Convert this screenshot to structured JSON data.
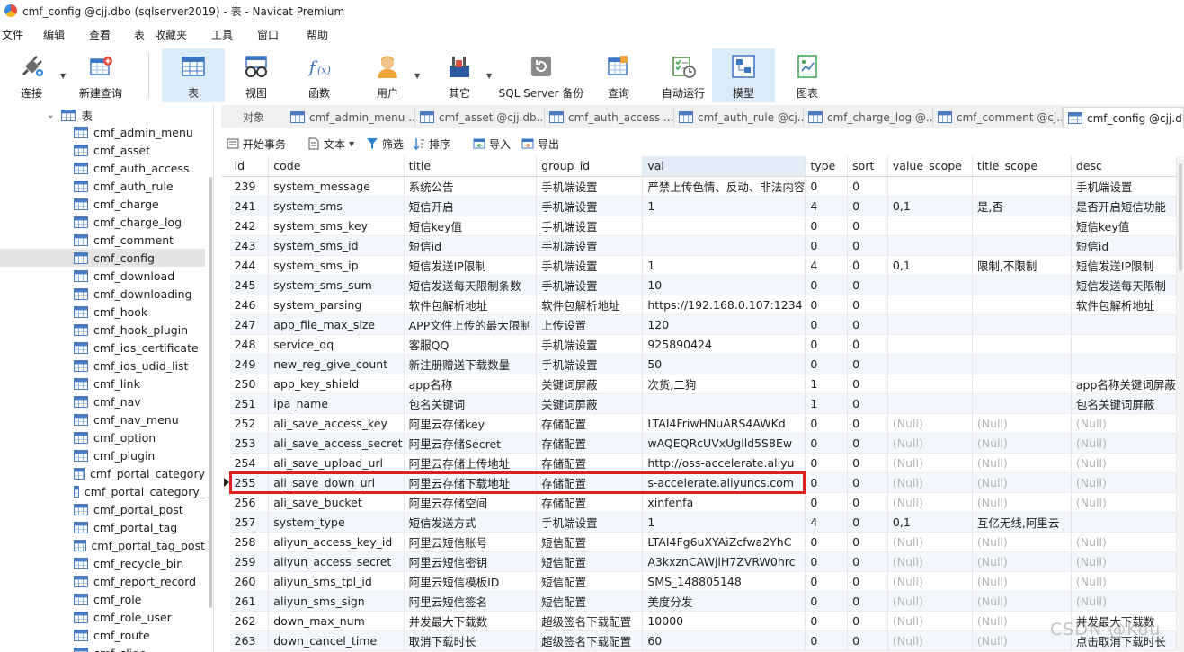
{
  "window": {
    "title": "cmf_config @cjj.dbo (sqlserver2019) - 表 - Navicat Premium"
  },
  "menu": [
    "文件",
    "编辑",
    "查看",
    "表",
    "收藏夹",
    "工具",
    "窗口",
    "帮助"
  ],
  "toolbar": {
    "connect": "连接",
    "new_query": "新建查询",
    "table": "表",
    "view": "视图",
    "function": "函数",
    "user": "用户",
    "other": "其它",
    "backup": "SQL Server 备份",
    "query": "查询",
    "automation": "自动运行",
    "model": "模型",
    "chart": "图表"
  },
  "sidebar": {
    "root_label": "表",
    "items": [
      "cmf_admin_menu",
      "cmf_asset",
      "cmf_auth_access",
      "cmf_auth_rule",
      "cmf_charge",
      "cmf_charge_log",
      "cmf_comment",
      "cmf_config",
      "cmf_download",
      "cmf_downloading",
      "cmf_hook",
      "cmf_hook_plugin",
      "cmf_ios_certificate",
      "cmf_ios_udid_list",
      "cmf_link",
      "cmf_nav",
      "cmf_nav_menu",
      "cmf_option",
      "cmf_plugin",
      "cmf_portal_category",
      "cmf_portal_category_",
      "cmf_portal_post",
      "cmf_portal_tag",
      "cmf_portal_tag_post",
      "cmf_recycle_bin",
      "cmf_report_record",
      "cmf_role",
      "cmf_role_user",
      "cmf_route",
      "cmf_slide"
    ],
    "selected": "cmf_config"
  },
  "tabs": {
    "objects": "对象",
    "items": [
      "cmf_admin_menu ...",
      "cmf_asset @cjj.db...",
      "cmf_auth_access ...",
      "cmf_auth_rule @cj...",
      "cmf_charge_log @...",
      "cmf_comment @cj...",
      "cmf_config @cjj.d..."
    ],
    "active": "cmf_config @cjj.d..."
  },
  "grid_toolbar": {
    "begin_tx": "开始事务",
    "text": "文本",
    "filter": "筛选",
    "sort": "排序",
    "import": "导入",
    "export": "导出"
  },
  "grid": {
    "columns": [
      "id",
      "code",
      "title",
      "group_id",
      "val",
      "type",
      "sort",
      "value_scope",
      "title_scope",
      "desc"
    ],
    "rows": [
      [
        "239",
        "system_message",
        "系统公告",
        "手机端设置",
        "严禁上传色情、反动、非法内容",
        "0",
        "0",
        "",
        "",
        "手机端设置"
      ],
      [
        "241",
        "system_sms",
        "短信开启",
        "手机端设置",
        "1",
        "4",
        "0",
        "0,1",
        "是,否",
        "是否开启短信功能"
      ],
      [
        "242",
        "system_sms_key",
        "短信key值",
        "手机端设置",
        "",
        "0",
        "0",
        "",
        "",
        "短信key值"
      ],
      [
        "243",
        "system_sms_id",
        "短信id",
        "手机端设置",
        "",
        "0",
        "0",
        "",
        "",
        "短信id"
      ],
      [
        "244",
        "system_sms_ip",
        "短信发送IP限制",
        "手机端设置",
        "1",
        "4",
        "0",
        "0,1",
        "限制,不限制",
        "短信发送IP限制"
      ],
      [
        "245",
        "system_sms_sum",
        "短信发送每天限制条数",
        "手机端设置",
        "10",
        "0",
        "0",
        "",
        "",
        "短信发送每天限制"
      ],
      [
        "246",
        "system_parsing",
        "软件包解析地址",
        "软件包解析地址",
        "https://192.168.0.107:1234",
        "0",
        "0",
        "",
        "",
        "软件包解析地址"
      ],
      [
        "247",
        "app_file_max_size",
        "APP文件上传的最大限制",
        "上传设置",
        "120",
        "0",
        "0",
        "",
        "",
        ""
      ],
      [
        "248",
        "service_qq",
        "客服QQ",
        "手机端设置",
        "925890424",
        "0",
        "0",
        "",
        "",
        ""
      ],
      [
        "249",
        "new_reg_give_count",
        "新注册赠送下载数量",
        "手机端设置",
        "50",
        "0",
        "0",
        "",
        "",
        ""
      ],
      [
        "250",
        "app_key_shield",
        "app名称",
        "关键词屏蔽",
        "次货,二狗",
        "1",
        "0",
        "",
        "",
        "app名称关键词屏蔽"
      ],
      [
        "251",
        "ipa_name",
        "包名关键词",
        "关键词屏蔽",
        "",
        "1",
        "0",
        "",
        "",
        "包名关键词屏蔽"
      ],
      [
        "252",
        "ali_save_access_key",
        "阿里云存储key",
        "存储配置",
        "LTAI4FriwHNuARS4AWKd",
        "0",
        "0",
        "(Null)",
        "(Null)",
        "(Null)"
      ],
      [
        "253",
        "ali_save_access_secret",
        "阿里云存储Secret",
        "存储配置",
        "wAQEQRcUVxUglld5S8Ew",
        "0",
        "0",
        "(Null)",
        "(Null)",
        "(Null)"
      ],
      [
        "254",
        "ali_save_upload_url",
        "阿里云存储上传地址",
        "存储配置",
        "http://oss-accelerate.aliyu",
        "0",
        "0",
        "(Null)",
        "(Null)",
        "(Null)"
      ],
      [
        "255",
        "ali_save_down_url",
        "阿里云存储下载地址",
        "存储配置",
        "s-accelerate.aliyuncs.com",
        "0",
        "0",
        "(Null)",
        "(Null)",
        "(Null)"
      ],
      [
        "256",
        "ali_save_bucket",
        "阿里云存储空间",
        "存储配置",
        "xinfenfa",
        "0",
        "0",
        "(Null)",
        "(Null)",
        "(Null)"
      ],
      [
        "257",
        "system_type",
        "短信发送方式",
        "手机端设置",
        "1",
        "4",
        "0",
        "0,1",
        "互亿无线,阿里云",
        ""
      ],
      [
        "258",
        "aliyun_access_key_id",
        "阿里云短信账号",
        "短信配置",
        "LTAI4Fg6uXYAiZcfwa2YhC",
        "0",
        "0",
        "(Null)",
        "(Null)",
        "(Null)"
      ],
      [
        "259",
        "aliyun_access_secret",
        "阿里云短信密钥",
        "短信配置",
        "A3kxznCAWjlH7ZVRW0hrc",
        "0",
        "0",
        "(Null)",
        "(Null)",
        "(Null)"
      ],
      [
        "260",
        "aliyun_sms_tpl_id",
        "阿里云短信模板ID",
        "短信配置",
        "SMS_148805148",
        "0",
        "0",
        "(Null)",
        "(Null)",
        "(Null)"
      ],
      [
        "261",
        "aliyun_sms_sign",
        "阿里云短信签名",
        "短信配置",
        "美度分发",
        "0",
        "0",
        "(Null)",
        "(Null)",
        "(Null)"
      ],
      [
        "262",
        "down_max_num",
        "并发最大下载数",
        "超级签名下载配置",
        "10000",
        "0",
        "0",
        "(Null)",
        "(Null)",
        "并发最大下载数"
      ],
      [
        "263",
        "down_cancel_time",
        "取消下载时长",
        "超级签名下载配置",
        "60",
        "0",
        "0",
        "(Null)",
        "(Null)",
        "点击取消下载时长"
      ]
    ],
    "current_row_id": "255"
  },
  "watermark": "CSDN @Kou"
}
